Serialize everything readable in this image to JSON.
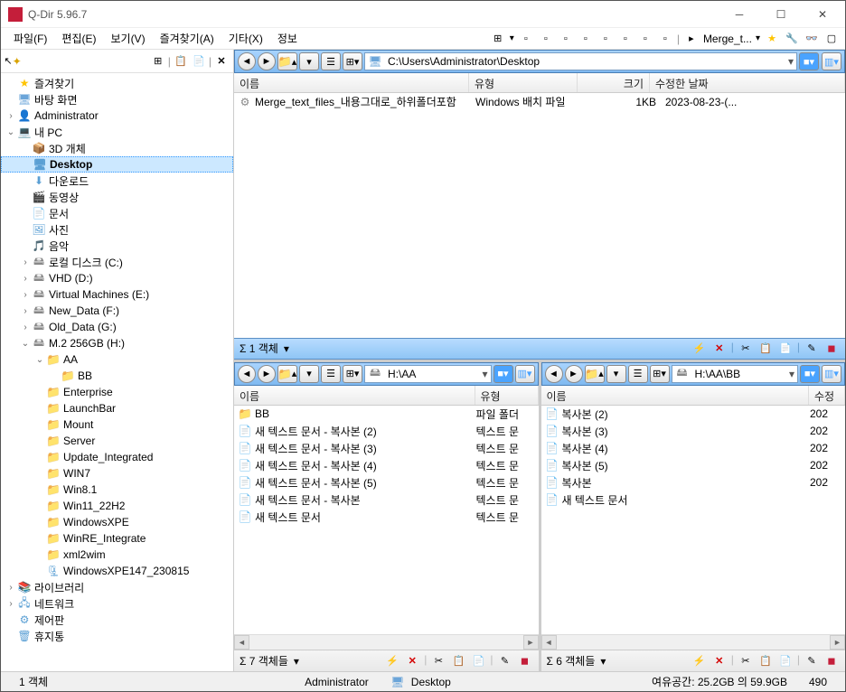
{
  "app": {
    "title": "Q-Dir 5.96.7"
  },
  "menu": {
    "file": "파일(F)",
    "edit": "편집(E)",
    "view": "보기(V)",
    "favorites": "즐겨찾기(A)",
    "extras": "기타(X)",
    "info": "정보",
    "merge_t": "Merge_t..."
  },
  "tree": {
    "favorites": "즐겨찾기",
    "desktop": "바탕 화면",
    "admin": "Administrator",
    "my_pc": "내 PC",
    "pc_children": [
      "3D 개체",
      "Desktop",
      "다운로드",
      "동영상",
      "문서",
      "사진",
      "음악",
      "로컬 디스크 (C:)",
      "VHD (D:)",
      "Virtual Machines (E:)",
      "New_Data (F:)",
      "Old_Data (G:)",
      "M.2 256GB (H:)"
    ],
    "aa": "AA",
    "bb": "BB",
    "h_dirs": [
      "Enterprise",
      "LaunchBar",
      "Mount",
      "Server",
      "Update_Integrated",
      "WIN7",
      "Win8.1",
      "Win11_22H2",
      "WindowsXPE",
      "WinRE_Integrate",
      "xml2wim"
    ],
    "zip": "WindowsXPE147_230815",
    "library": "라이브러리",
    "network": "네트워크",
    "control": "제어판",
    "recycle": "휴지통"
  },
  "top_pane": {
    "path": "C:\\Users\\Administrator\\Desktop",
    "cols": {
      "name": "이름",
      "type": "유형",
      "size": "크기",
      "date": "수정한 날짜"
    },
    "row": {
      "name": "Merge_text_files_내용그대로_하위폴더포함",
      "type": "Windows 배치 파일",
      "size": "1KB",
      "date": "2023-08-23-(..."
    }
  },
  "mid": {
    "left": "Σ  1 객체",
    "dd": "▾"
  },
  "bl": {
    "path": "H:\\AA",
    "cols": {
      "name": "이름",
      "type": "유형"
    },
    "rows": [
      {
        "n": "BB",
        "t": "파일 폴더",
        "folder": true
      },
      {
        "n": "새 텍스트 문서 - 복사본 (2)",
        "t": "텍스트 문"
      },
      {
        "n": "새 텍스트 문서 - 복사본 (3)",
        "t": "텍스트 문"
      },
      {
        "n": "새 텍스트 문서 - 복사본 (4)",
        "t": "텍스트 문"
      },
      {
        "n": "새 텍스트 문서 - 복사본 (5)",
        "t": "텍스트 문"
      },
      {
        "n": "새 텍스트 문서 - 복사본",
        "t": "텍스트 문"
      },
      {
        "n": "새 텍스트 문서",
        "t": "텍스트 문"
      }
    ],
    "status": "Σ  7 객체들"
  },
  "br": {
    "path": "H:\\AA\\BB",
    "cols": {
      "name": "이름",
      "date": "수정"
    },
    "rows": [
      {
        "n": "복사본 (2)",
        "d": "202"
      },
      {
        "n": "복사본 (3)",
        "d": "202"
      },
      {
        "n": "복사본 (4)",
        "d": "202"
      },
      {
        "n": "복사본 (5)",
        "d": "202"
      },
      {
        "n": "복사본",
        "d": "202"
      },
      {
        "n": "새 텍스트 문서",
        "d": ""
      }
    ],
    "status": "Σ  6 객체들"
  },
  "status": {
    "left": "1 객체",
    "admin": "Administrator",
    "desktop": "Desktop",
    "free": "여유공간: 25.2GB 의 59.9GB",
    "num": "490"
  }
}
